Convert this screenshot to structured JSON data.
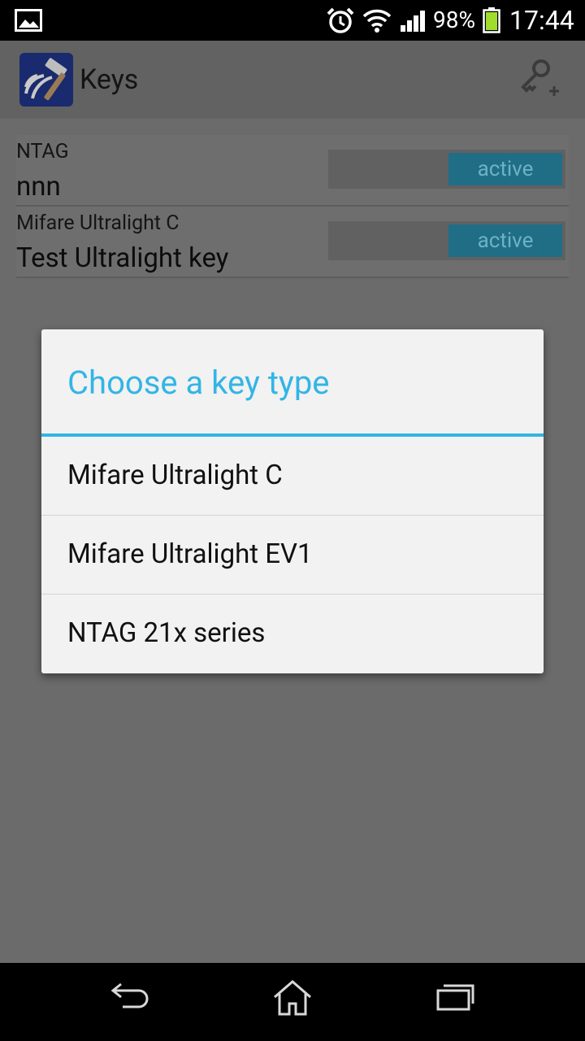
{
  "status_bar": {
    "battery_percent": "98%",
    "time": "17:44",
    "icons": [
      "gallery-icon",
      "alarm-icon",
      "wifi-icon",
      "signal-icon",
      "battery-icon"
    ]
  },
  "action_bar": {
    "title": "Keys",
    "add_icon": "key-add-icon"
  },
  "keys": [
    {
      "type": "NTAG",
      "name": "nnn",
      "state": "active"
    },
    {
      "type": "Mifare Ultralight C",
      "name": "Test Ultralight key",
      "state": "active"
    }
  ],
  "dialog": {
    "title": "Choose a key type",
    "options": [
      "Mifare Ultralight C",
      "Mifare Ultralight EV1",
      "NTAG 21x series"
    ]
  },
  "colors": {
    "accent": "#33b5e5",
    "toggle_on": "#1f6e86",
    "scrim_bg": "#6b6b6b"
  },
  "nav_bar": {
    "icons": [
      "back-icon",
      "home-icon",
      "recents-icon"
    ]
  }
}
